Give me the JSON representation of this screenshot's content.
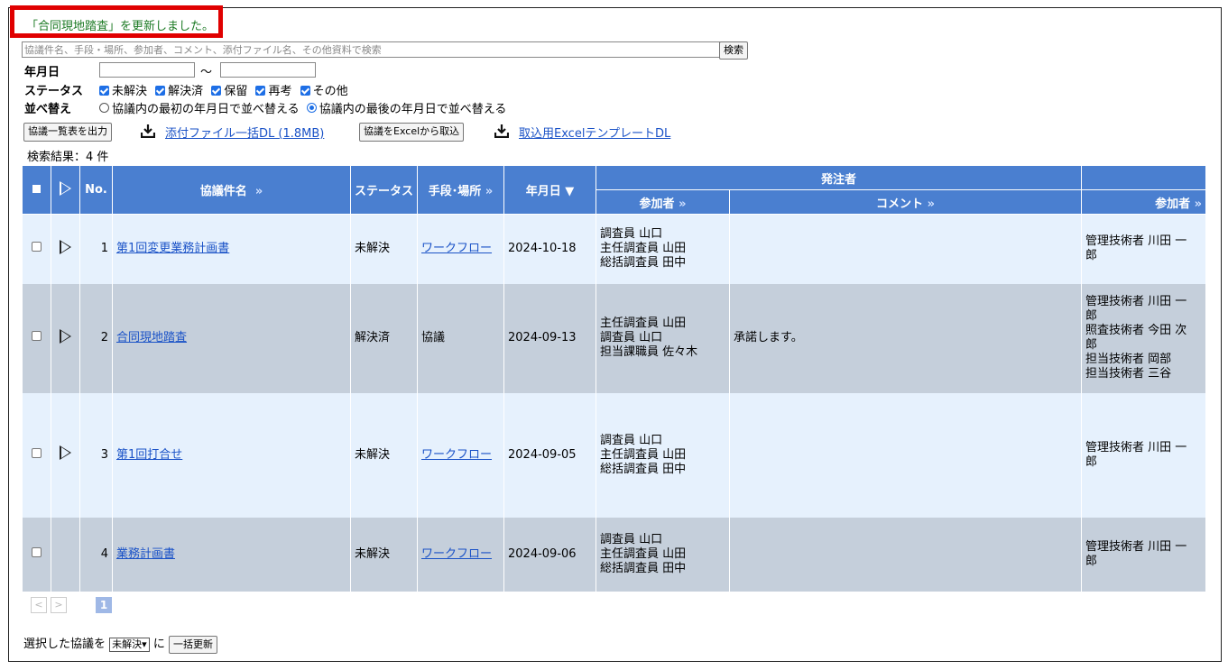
{
  "notice": "「合同現地踏査」を更新しました。",
  "search": {
    "placeholder": "協議件名、手段・場所、参加者、コメント、添付ファイル名、その他資料で検索",
    "value": "",
    "button": "検索"
  },
  "filters": {
    "date_label": "年月日",
    "date_sep": "～",
    "status_label": "ステータス",
    "status_options": [
      {
        "label": "未解決",
        "checked": true
      },
      {
        "label": "解決済",
        "checked": true
      },
      {
        "label": "保留",
        "checked": true
      },
      {
        "label": "再考",
        "checked": true
      },
      {
        "label": "その他",
        "checked": true
      }
    ],
    "sort_label": "並べ替え",
    "sort_options": [
      {
        "label": "協議内の最初の年月日で並べ替える",
        "selected": false
      },
      {
        "label": "協議内の最後の年月日で並べ替える",
        "selected": true
      }
    ]
  },
  "toolbar": {
    "export_button": "協議一覧表を出力",
    "attach_dl_link": "添付ファイル一括DL (1.8MB)",
    "import_button": "協議をExcelから取込",
    "template_link": "取込用Excelテンプレートをダウンロード",
    "template_link_visible": "取込用Excelテンプレート",
    "template_link_suffix": "DL"
  },
  "result_count": "検索結果：4 件",
  "table": {
    "headers": {
      "no": "No.",
      "title": "協議件名",
      "status": "ステータス",
      "place": "手段･場所",
      "date": "年月日 ▼",
      "group_orderer": "発注者",
      "participants": "参加者",
      "comment": "コメント",
      "participants2": "参加者",
      "more": "»"
    },
    "rows": [
      {
        "no": "1",
        "title": "第1回変更業務計画書",
        "status": "未解決",
        "place": "ワークフロー",
        "place_link": true,
        "date": "2024-10-18",
        "participants": "調査員 山口\n主任調査員 山田\n総括調査員 田中",
        "comment": "",
        "participants2": "管理技術者 川田 一\n郎",
        "has_play": true
      },
      {
        "no": "2",
        "title": "合同現地踏査",
        "status": "解決済",
        "place": "協議",
        "place_link": false,
        "date": "2024-09-13",
        "participants": "主任調査員 山田\n調査員 山口\n担当課職員 佐々木",
        "comment": "承諾します。",
        "participants2": "管理技術者 川田 一\n郎\n照査技術者 今田 次\n郎\n担当技術者 岡部\n担当技術者 三谷",
        "has_play": true
      },
      {
        "no": "3",
        "title": "第1回打合せ",
        "status": "未解決",
        "place": "ワークフロー",
        "place_link": true,
        "date": "2024-09-05",
        "participants": "調査員 山口\n主任調査員 山田\n総括調査員 田中",
        "comment": "",
        "participants2": "管理技術者 川田 一\n郎",
        "has_play": true
      },
      {
        "no": "4",
        "title": "業務計画書",
        "status": "未解決",
        "place": "ワークフロー",
        "place_link": true,
        "date": "2024-09-06",
        "participants": "調査員 山口\n主任調査員 山田\n総括調査員 田中",
        "comment": "",
        "participants2": "管理技術者 川田 一\n郎",
        "has_play": false
      }
    ]
  },
  "pager": {
    "prev": "<",
    "next": ">",
    "current": "1"
  },
  "bulk": {
    "prefix": "選択した協議を",
    "select_value": "未解決",
    "mid": "に",
    "button": "一括更新"
  },
  "colors": {
    "header_bg": "#4a7fd0",
    "row_light": "#e6f1fd",
    "row_dark": "#c5cfdb",
    "notice_border": "#e00000",
    "notice_text": "#1c7a24",
    "link": "#1a52c7"
  }
}
